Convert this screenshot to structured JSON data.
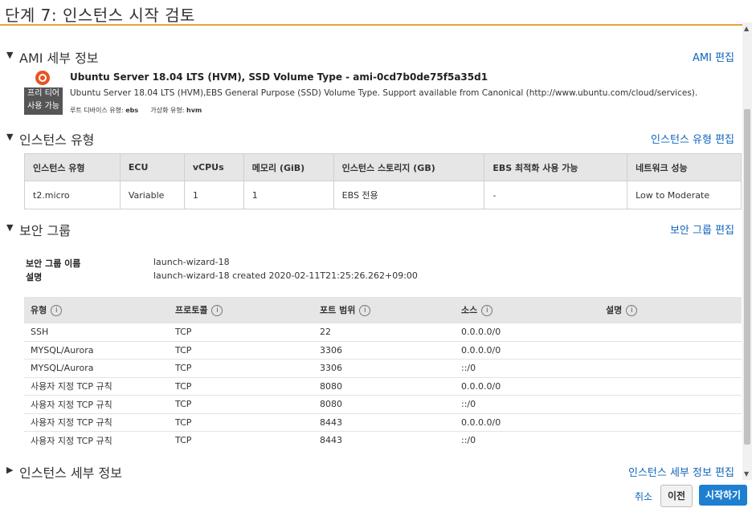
{
  "page": {
    "title": "단계 7: 인스턴스 시작 검토"
  },
  "ami_section": {
    "title": "AMI 세부 정보",
    "edit_link": "AMI 편집",
    "badge_line1": "프리 티어",
    "badge_line2": "사용 가능",
    "name": "Ubuntu Server 18.04 LTS (HVM), SSD Volume Type - ami-0cd7b0de75f5a35d1",
    "description": "Ubuntu Server 18.04 LTS (HVM),EBS General Purpose (SSD) Volume Type. Support available from Canonical (http://www.ubuntu.com/cloud/services).",
    "root_device_label": "루트 디바이스 유형:",
    "root_device_value": "ebs",
    "virt_label": "가상화 유형:",
    "virt_value": "hvm"
  },
  "instance_type_section": {
    "title": "인스턴스 유형",
    "edit_link": "인스턴스 유형 편집",
    "headers": [
      "인스턴스 유형",
      "ECU",
      "vCPUs",
      "메모리 (GiB)",
      "인스턴스 스토리지 (GB)",
      "EBS 최적화 사용 가능",
      "네트워크 성능"
    ],
    "row": [
      "t2.micro",
      "Variable",
      "1",
      "1",
      "EBS 전용",
      "-",
      "Low to Moderate"
    ]
  },
  "security_group_section": {
    "title": "보안 그룹",
    "edit_link": "보안 그룹 편집",
    "name_label": "보안 그룹 이름",
    "name_value": "launch-wizard-18",
    "desc_label": "설명",
    "desc_value": "launch-wizard-18 created 2020-02-11T21:25:26.262+09:00",
    "headers": [
      "유형",
      "프로토콜",
      "포트 범위",
      "소스",
      "설명"
    ],
    "rows": [
      [
        "SSH",
        "TCP",
        "22",
        "0.0.0.0/0",
        ""
      ],
      [
        "MYSQL/Aurora",
        "TCP",
        "3306",
        "0.0.0.0/0",
        ""
      ],
      [
        "MYSQL/Aurora",
        "TCP",
        "3306",
        "::/0",
        ""
      ],
      [
        "사용자 지정 TCP 규칙",
        "TCP",
        "8080",
        "0.0.0.0/0",
        ""
      ],
      [
        "사용자 지정 TCP 규칙",
        "TCP",
        "8080",
        "::/0",
        ""
      ],
      [
        "사용자 지정 TCP 규칙",
        "TCP",
        "8443",
        "0.0.0.0/0",
        ""
      ],
      [
        "사용자 지정 TCP 규칙",
        "TCP",
        "8443",
        "::/0",
        ""
      ]
    ]
  },
  "instance_details_section": {
    "title": "인스턴스 세부 정보",
    "edit_link": "인스턴스 세부 정보 편집"
  },
  "footer": {
    "cancel": "취소",
    "previous": "이전",
    "launch": "시작하기"
  },
  "icons": {
    "info": "i",
    "expanded": "▼",
    "collapsed": "▶"
  },
  "colors": {
    "accent": "#e8a33d",
    "link": "#1166bb",
    "primary_button": "#1e7fd1"
  }
}
